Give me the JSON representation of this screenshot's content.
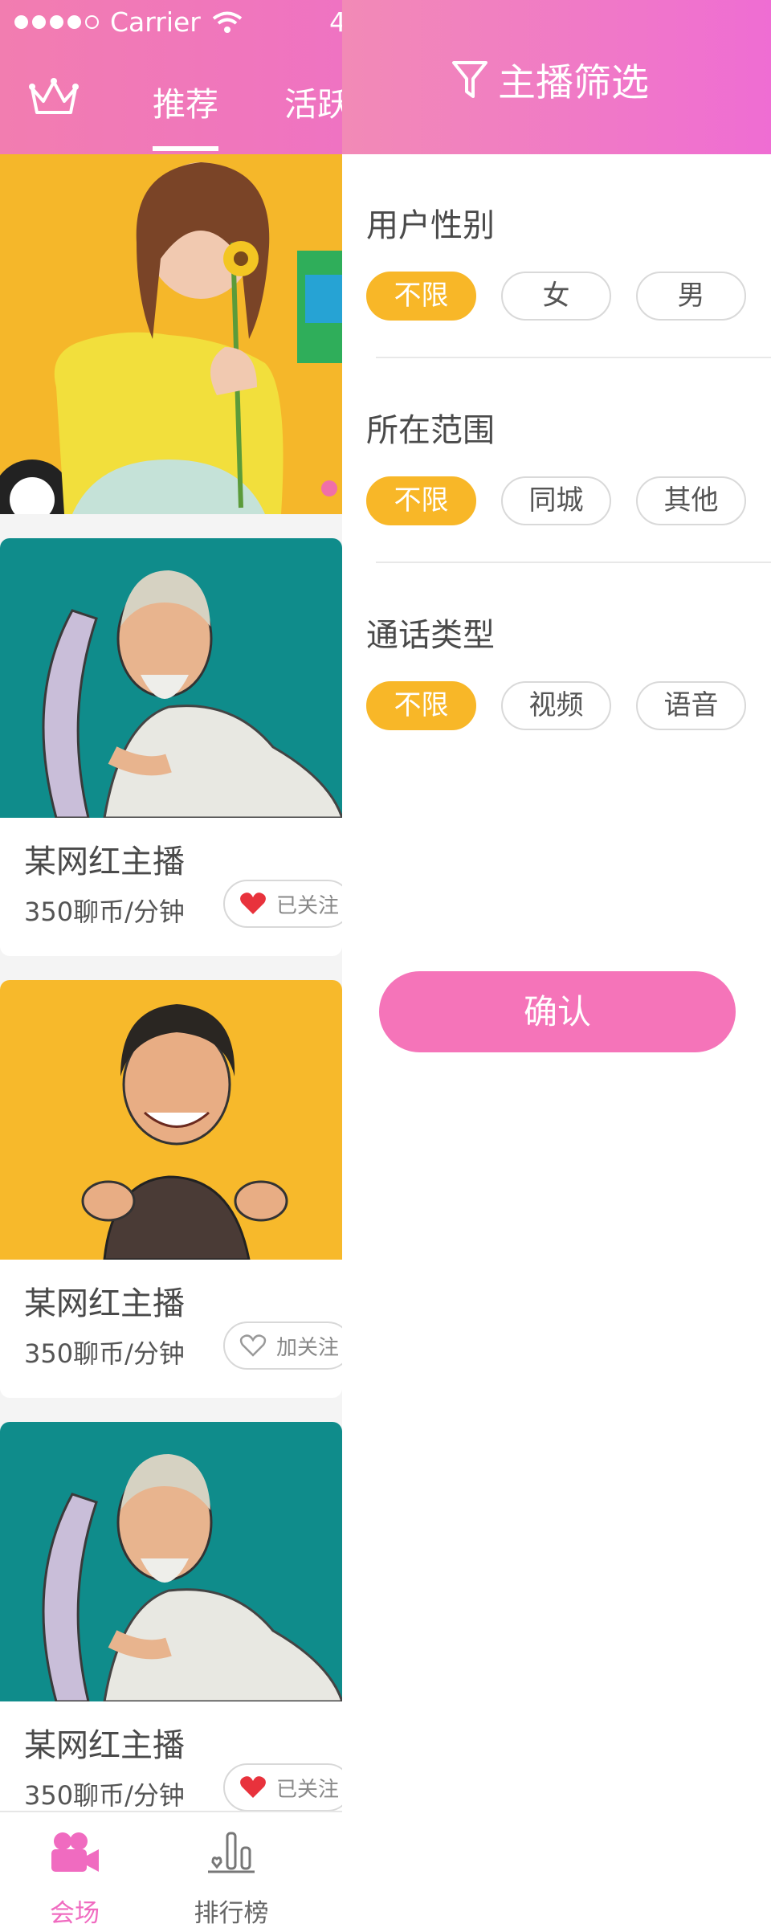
{
  "status_bar": {
    "carrier": "Carrier",
    "time": "4"
  },
  "nav": {
    "tabs": [
      "推荐",
      "活跃"
    ],
    "active_tab": "推荐"
  },
  "cards": [
    {
      "name": "某网红主播",
      "price": "350聊币/分钟",
      "follow": "已关注",
      "followed": true
    },
    {
      "name": "某网红主播",
      "price": "350聊币/分钟",
      "follow": "加关注",
      "followed": false
    },
    {
      "name": "某网红主播",
      "price": "350聊币/分钟",
      "follow": "已关注",
      "followed": true
    }
  ],
  "tabbar": {
    "items": [
      {
        "label": "会场",
        "icon": "camera-icon"
      },
      {
        "label": "排行榜",
        "icon": "chart-icon"
      }
    ]
  },
  "filter": {
    "title": "主播筛选",
    "sections": [
      {
        "title": "用户性别",
        "options": [
          "不限",
          "女",
          "男"
        ],
        "selected": "不限"
      },
      {
        "title": "所在范围",
        "options": [
          "不限",
          "同城",
          "其他"
        ],
        "selected": "不限"
      },
      {
        "title": "通话类型",
        "options": [
          "不限",
          "视频",
          "语音"
        ],
        "selected": "不限"
      }
    ],
    "confirm_label": "确认"
  },
  "colors": {
    "header_pink": "#f27db0",
    "accent_yellow": "#f8b728",
    "confirm_pink": "#f574b9",
    "heart_red": "#e8323c"
  }
}
